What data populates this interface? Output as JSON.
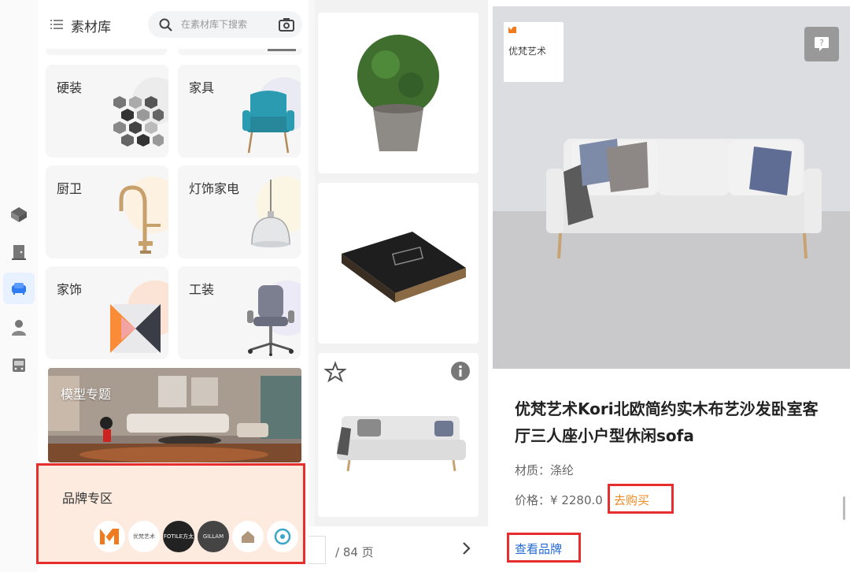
{
  "library": {
    "title": "素材库",
    "search_placeholder": "在素材库下搜索"
  },
  "categories": [
    {
      "label": "硬装"
    },
    {
      "label": "家具"
    },
    {
      "label": "厨卫"
    },
    {
      "label": "灯饰家电"
    },
    {
      "label": "家饰"
    },
    {
      "label": "工装"
    }
  ],
  "topic": {
    "label": "模型专题"
  },
  "brand_zone": {
    "title": "品牌专区",
    "brands": [
      "M",
      "优梵艺术",
      "FOTILE方太",
      "GILLAM",
      "",
      "多乐士"
    ]
  },
  "rail": {
    "items": [
      "model-icon",
      "door-icon",
      "sofa-icon",
      "person-icon",
      "bus-icon"
    ],
    "active_index": 2
  },
  "pager": {
    "total_label": "/ 84 页"
  },
  "product": {
    "brand_badge": "优梵艺术",
    "title": "优梵艺术Kori北欧简约实木布艺沙发卧室客厅三人座小户型休闲sofa",
    "material_label": "材质：",
    "material_value": "涤纶",
    "price_label": "价格：",
    "price_value": "¥ 2280.0",
    "buy_label": "去购买",
    "brand_link_label": "查看品牌"
  },
  "colors": {
    "highlight_red": "#e62e2e",
    "buy_orange": "#f08a24",
    "link_blue": "#2268d6",
    "active_rail": "#2f7bf5"
  }
}
